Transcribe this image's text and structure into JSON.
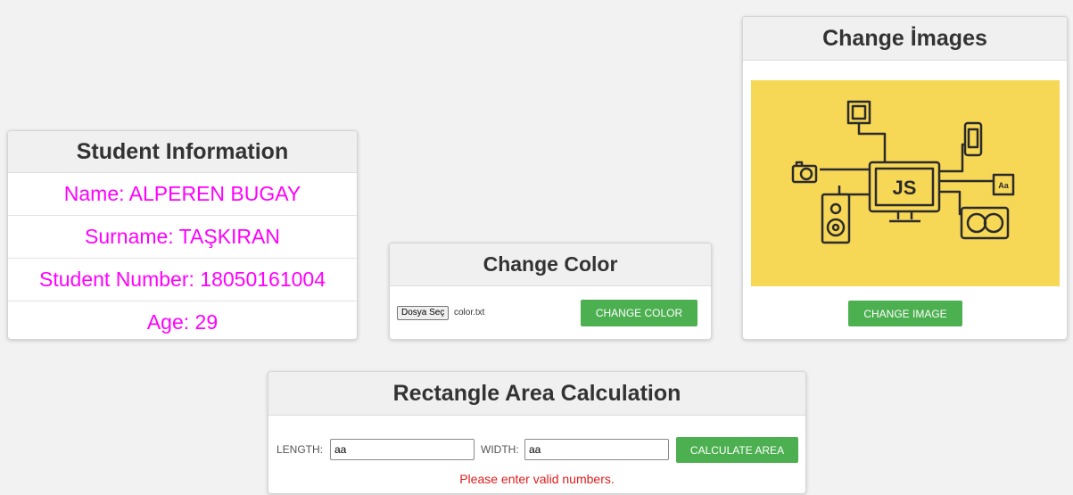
{
  "student": {
    "title": "Student Information",
    "name": "Name: ALPEREN BUGAY",
    "surname": "Surname: TAŞKIRAN",
    "number": "Student Number: 18050161004",
    "age": "Age: 29",
    "text_color": "#ff00ff"
  },
  "color_card": {
    "title": "Change Color",
    "file_button": "Dosya Seç",
    "file_name": "color.txt",
    "button": "CHANGE COLOR"
  },
  "images_card": {
    "title": "Change İmages",
    "image_text": "JS",
    "image_background": "#f7d756",
    "button": "CHANGE IMAGE"
  },
  "rect_card": {
    "title": "Rectangle Area Calculation",
    "length_label": "LENGTH:",
    "length_value": "aa",
    "width_label": "WIDTH:",
    "width_value": "aa",
    "button": "CALCULATE AREA",
    "error": "Please enter valid numbers."
  },
  "colors": {
    "accent_button": "#4caf50",
    "error": "#e31b1b"
  }
}
